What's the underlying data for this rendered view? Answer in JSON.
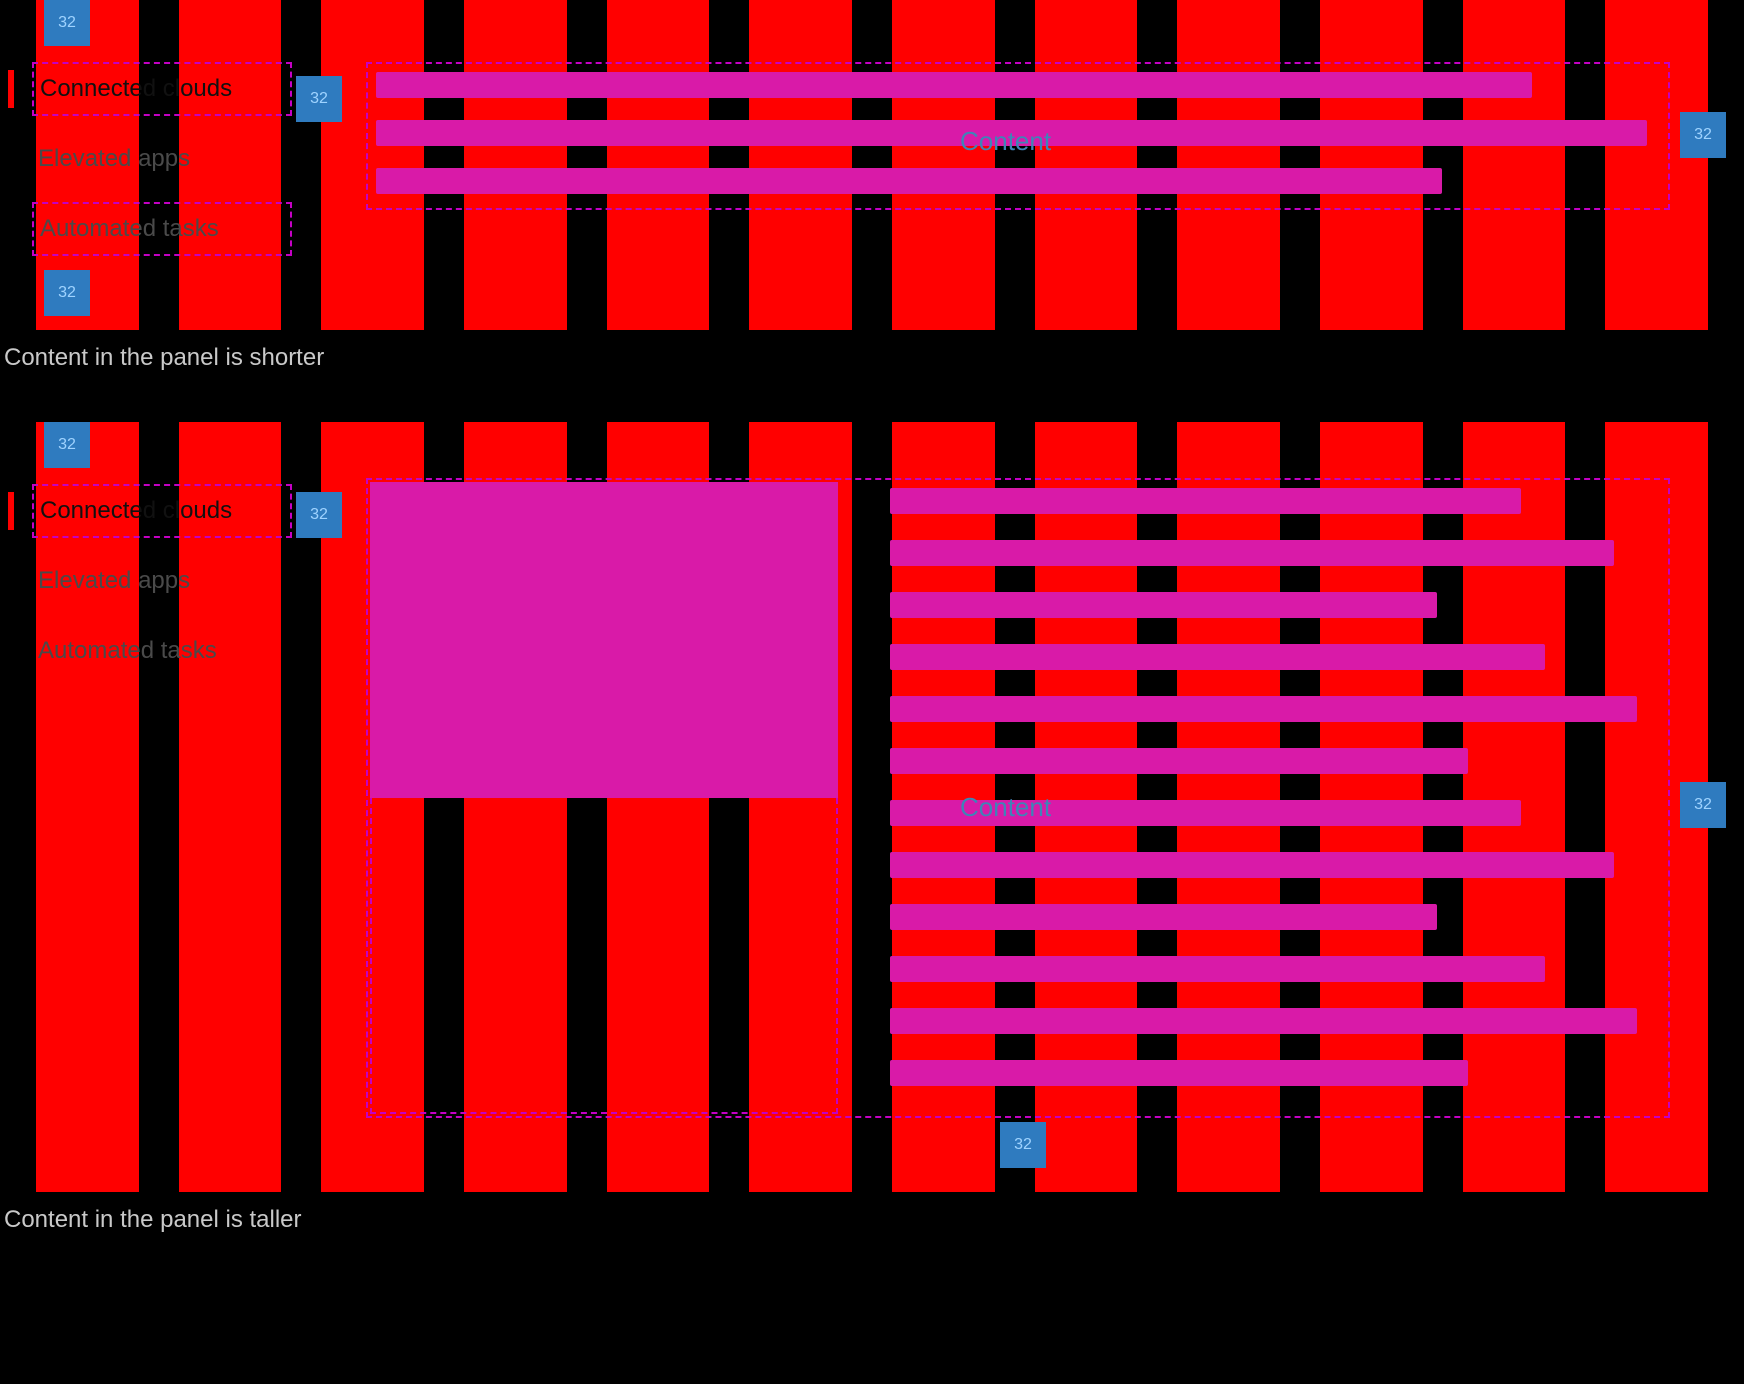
{
  "spacer_label": "32",
  "nav": {
    "items": [
      {
        "label": "Connected clouds",
        "active": true
      },
      {
        "label": "Elevated apps",
        "active": false
      },
      {
        "label": "Automated tasks",
        "active": false
      }
    ]
  },
  "panel_label": "Content",
  "captions": {
    "shorter": "Content in the panel is shorter",
    "taller": "Content in the panel is taller"
  },
  "example1": {
    "bar_widths_pct": [
      90,
      99,
      83
    ]
  },
  "example2": {
    "bar_widths_pct": [
      82,
      94,
      71,
      85,
      97,
      75,
      82,
      94,
      71,
      85,
      97,
      75
    ]
  },
  "colors": {
    "column": "#ff0000",
    "bar": "#d91aa8",
    "dash": "#c400c4",
    "spacer_bg": "#2f7bbf",
    "spacer_text": "#9fd3ff",
    "caption": "#c9c9c9",
    "panel_label": "#3f84b7"
  }
}
